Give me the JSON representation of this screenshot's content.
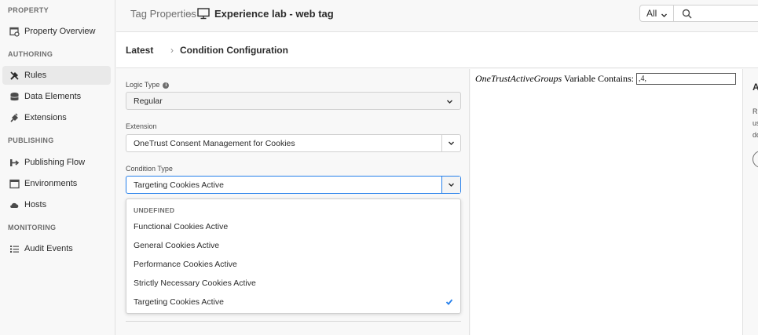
{
  "sidebar": {
    "sections": {
      "property": "PROPERTY",
      "authoring": "AUTHORING",
      "publishing": "PUBLISHING",
      "monitoring": "MONITORING"
    },
    "items": [
      {
        "label": "Property Overview",
        "icon": "property-overview-icon"
      },
      {
        "label": "Rules",
        "icon": "rules-icon",
        "active": true
      },
      {
        "label": "Data Elements",
        "icon": "data-elements-icon"
      },
      {
        "label": "Extensions",
        "icon": "extensions-icon"
      },
      {
        "label": "Publishing Flow",
        "icon": "publishing-flow-icon"
      },
      {
        "label": "Environments",
        "icon": "environments-icon"
      },
      {
        "label": "Hosts",
        "icon": "hosts-icon"
      },
      {
        "label": "Audit Events",
        "icon": "audit-events-icon"
      }
    ]
  },
  "header": {
    "breadcrumb_root": "Tag Properties",
    "breadcrumb_sep": "›",
    "property_name": "Experience lab - web tag",
    "search_scope": "All",
    "search_placeholder": ""
  },
  "subheader": {
    "latest": "Latest",
    "sep": "›",
    "title": "Condition Configuration"
  },
  "form": {
    "logic_type": {
      "label": "Logic Type",
      "value": "Regular"
    },
    "extension": {
      "label": "Extension",
      "value": "OneTrust Consent Management for Cookies"
    },
    "condition_type": {
      "label": "Condition Type",
      "value": "Targeting Cookies Active"
    }
  },
  "dropdown": {
    "header": "UNDEFINED",
    "options": [
      "Functional Cookies Active",
      "General Cookies Active",
      "Performance Cookies Active",
      "Strictly Necessary Cookies Active",
      "Targeting Cookies Active"
    ],
    "selected": "Targeting Cookies Active"
  },
  "condition_view": {
    "variable_name": "OneTrustActiveGroups",
    "text": "Variable Contains:",
    "input_value": ",4,"
  },
  "right_panel": {
    "title_fragment": "A",
    "lines": [
      "Ru",
      "us",
      "do"
    ]
  },
  "colors": {
    "accent": "#2680eb",
    "background": "#f8f8f8",
    "text": "#2c2c2c"
  }
}
